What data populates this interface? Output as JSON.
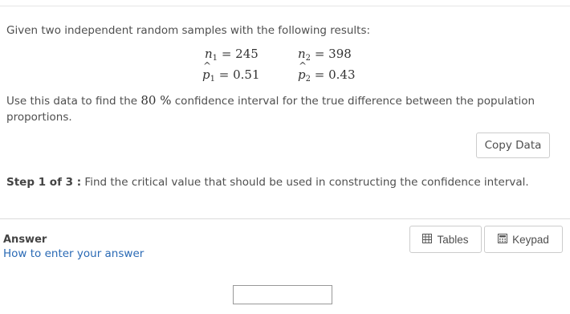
{
  "problem": {
    "intro": "Given two independent random samples with the following results:",
    "n1_label": "1",
    "n1_value": "245",
    "n2_label": "2",
    "n2_value": "398",
    "p1_label": "1",
    "p1_value": "0.51",
    "p2_label": "2",
    "p2_value": "0.43",
    "instruction_before": "Use this data to find the ",
    "confidence": "80 %",
    "instruction_after": " confidence interval for the true difference between the population proportions."
  },
  "copy_button": "Copy Data",
  "step": {
    "label": "Step 1 of 3 :",
    "text": " Find the critical value that should be used in constructing the confidence interval."
  },
  "answer": {
    "label": "Answer",
    "help_link": "How to enter your answer",
    "tables_button": "Tables",
    "keypad_button": "Keypad",
    "input_value": ""
  },
  "icons": {
    "tables": "table-grid-icon",
    "keypad": "calculator-icon"
  }
}
